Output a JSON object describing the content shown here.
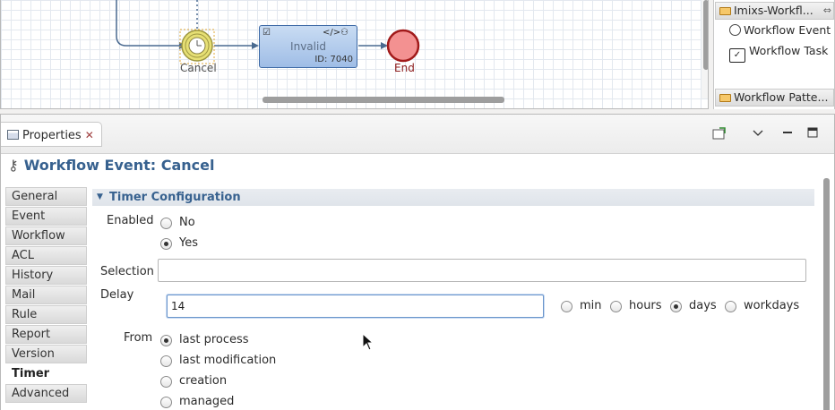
{
  "diagram": {
    "cancel_event_label": "Cancel",
    "task": {
      "title": "Invalid",
      "id_text": "ID: 7040"
    },
    "end_event_label": "End"
  },
  "palette": {
    "group_imixs": "Imixs-Workfl...",
    "item_event": "Workflow Event",
    "item_task": "Workflow Task",
    "group_patterns": "Workflow Patte..."
  },
  "properties": {
    "tab_label": "Properties",
    "page_title": "Workflow Event: Cancel",
    "side_tabs": [
      "General",
      "Event",
      "Workflow",
      "ACL",
      "History",
      "Mail",
      "Rule",
      "Report",
      "Version",
      "Timer",
      "Advanced"
    ],
    "active_side_tab": "Timer",
    "section_title": "Timer Configuration",
    "enabled": {
      "label": "Enabled",
      "options": [
        "No",
        "Yes"
      ],
      "selected": "Yes"
    },
    "selection": {
      "label": "Selection",
      "value": ""
    },
    "delay": {
      "label": "Delay",
      "value": "14",
      "units": [
        "min",
        "hours",
        "days",
        "workdays"
      ],
      "selected_unit": "days"
    },
    "from": {
      "label": "From",
      "options": [
        "last process",
        "last modification",
        "creation",
        "managed"
      ],
      "selected": "last process"
    }
  },
  "colors": {
    "accent": "#37618f",
    "task_fill": "#b4ccee",
    "end_fill": "#f08080",
    "timer_event_fill": "#e8e070"
  }
}
